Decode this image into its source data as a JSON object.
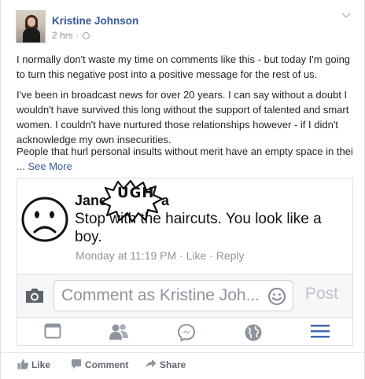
{
  "post": {
    "author": "Kristine Johnson",
    "timestamp": "2 hrs",
    "separator": "·",
    "paragraphs": [
      "I normally don't waste my time on comments like this - but today I'm going to turn this negative post into a positive message for the rest of us.",
      "I've been in broadcast news for over 20 years. I can say without a doubt I wouldn't have survived this long without the support of talented and smart women. I couldn't have nurtured those relationships however - if I didn't acknowledge my own insecurities.",
      "People that hurl personal insults without merit have an empty space in thei"
    ],
    "see_more_prefix": "... ",
    "see_more": "See More"
  },
  "screenshot": {
    "sticker_text": "UGH",
    "commenter_visible": "Jane",
    "commenter_tail": "a",
    "comment": "Stop with the haircuts. You look like a boy.",
    "comment_time": "Monday at 11:19 PM",
    "dot": " · ",
    "like_label": "Like",
    "reply_label": "Reply",
    "comment_placeholder": "Comment as Kristine Joh...",
    "post_label": "Post",
    "nav_icons": [
      "news-feed-icon",
      "friends-icon",
      "messenger-icon",
      "globe-icon",
      "menu-icon"
    ],
    "accent": "#4267b2"
  },
  "actions": {
    "like": "Like",
    "comment": "Comment",
    "share": "Share"
  },
  "colors": {
    "link": "#365899",
    "muted": "#90949c",
    "action": "#606770"
  }
}
